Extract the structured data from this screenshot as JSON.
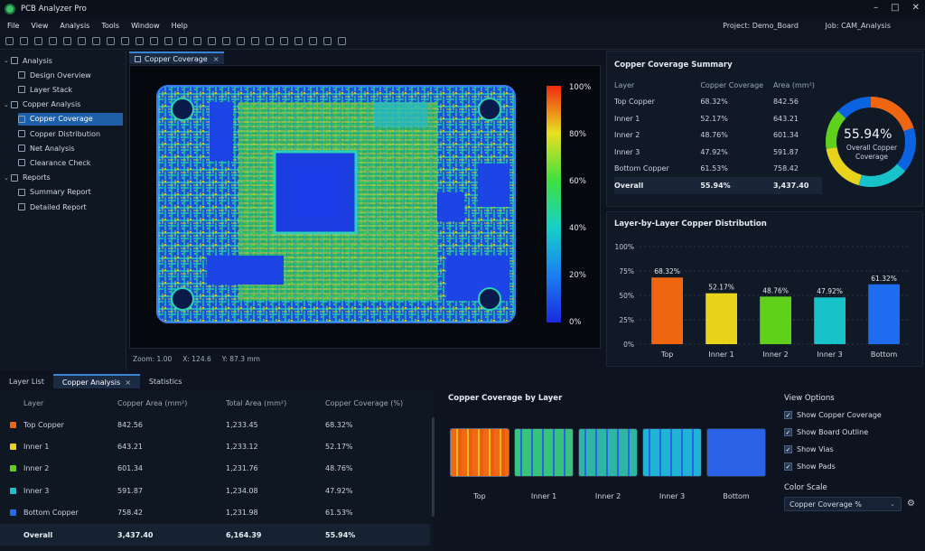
{
  "app": {
    "title": "PCB Analyzer Pro",
    "project": "Project: Demo_Board",
    "job": "Job: CAM_Analysis"
  },
  "menu": [
    "File",
    "View",
    "Analysis",
    "Tools",
    "Window",
    "Help"
  ],
  "tree": {
    "items": [
      {
        "label": "Analysis",
        "level": 0
      },
      {
        "label": "Design Overview",
        "level": 1
      },
      {
        "label": "Layer Stack",
        "level": 1
      },
      {
        "label": "Copper Analysis",
        "level": 0
      },
      {
        "label": "Copper Coverage",
        "level": 1,
        "selected": true
      },
      {
        "label": "Copper Distribution",
        "level": 1
      },
      {
        "label": "Net Analysis",
        "level": 1
      },
      {
        "label": "Clearance Check",
        "level": 1
      },
      {
        "label": "Reports",
        "level": 0
      },
      {
        "label": "Summary Report",
        "level": 1
      },
      {
        "label": "Detailed Report",
        "level": 1
      }
    ]
  },
  "viewer": {
    "tab": "Copper Coverage",
    "scale_labels": [
      "100%",
      "80%",
      "60%",
      "40%",
      "20%",
      "0%"
    ],
    "zoom": "Zoom: 1.00",
    "x": "X: 124.6",
    "y": "Y: 87.3 mm"
  },
  "summary": {
    "title": "Copper Coverage Summary",
    "headers": [
      "Layer",
      "Copper Coverage",
      "Area (mm²)"
    ],
    "rows": [
      [
        "Top Copper",
        "68.32%",
        "842.56"
      ],
      [
        "Inner 1",
        "52.17%",
        "643.21"
      ],
      [
        "Inner 2",
        "48.76%",
        "601.34"
      ],
      [
        "Inner 3",
        "47.92%",
        "591.87"
      ],
      [
        "Bottom Copper",
        "61.53%",
        "758.42"
      ]
    ],
    "total": [
      "Overall",
      "55.94%",
      "3,437.40"
    ],
    "donut_value": "55.94%",
    "donut_label": "Overall Copper Coverage"
  },
  "chart_data": {
    "type": "bar",
    "title": "Layer-by-Layer Copper Distribution",
    "categories": [
      "Top",
      "Inner 1",
      "Inner 2",
      "Inner 3",
      "Bottom"
    ],
    "values": [
      68.32,
      52.17,
      48.76,
      47.92,
      61.32
    ],
    "value_labels": [
      "68.32%",
      "52.17%",
      "48.76%",
      "47.92%",
      "61.32%"
    ],
    "colors": [
      "#f0650f",
      "#e8d21a",
      "#5fd11a",
      "#17c3c8",
      "#1f6cf0"
    ],
    "ylim": [
      0,
      100
    ],
    "yticks": [
      "0%",
      "25%",
      "50%",
      "75%",
      "100%"
    ]
  },
  "bottom_tabs": [
    "Layer List",
    "Copper Analysis",
    "Statistics"
  ],
  "layer_table": {
    "headers": [
      "Layer",
      "Copper Area (mm²)",
      "Total Area (mm²)",
      "Copper Coverage (%)"
    ],
    "rows": [
      [
        "Top Copper",
        "842.56",
        "1,233.45",
        "68.32%"
      ],
      [
        "Inner 1",
        "643.21",
        "1,233.12",
        "52.17%"
      ],
      [
        "Inner 2",
        "601.34",
        "1,231.76",
        "48.76%"
      ],
      [
        "Inner 3",
        "591.87",
        "1,234.08",
        "47.92%"
      ],
      [
        "Bottom Copper",
        "758.42",
        "1,231.98",
        "61.53%"
      ]
    ],
    "swatches": [
      "#f0650f",
      "#e8d21a",
      "#5fd11a",
      "#17c3c8",
      "#1f6cf0"
    ],
    "total": [
      "Overall",
      "3,437.40",
      "6,164.39",
      "55.94%"
    ]
  },
  "thumbs": {
    "title": "Copper Coverage by Layer",
    "labels": [
      "Top",
      "Inner 1",
      "Inner 2",
      "Inner 3",
      "Bottom"
    ],
    "colors": [
      "#f0650f",
      "#37c47a",
      "#2fb6a2",
      "#1fb3d6",
      "#2a63e8"
    ]
  },
  "view_options": {
    "title": "View Options",
    "options": [
      "Show Copper Coverage",
      "Show Board Outline",
      "Show Vias",
      "Show Pads"
    ],
    "scale_title": "Color Scale",
    "scale_value": "Copper Coverage %"
  }
}
